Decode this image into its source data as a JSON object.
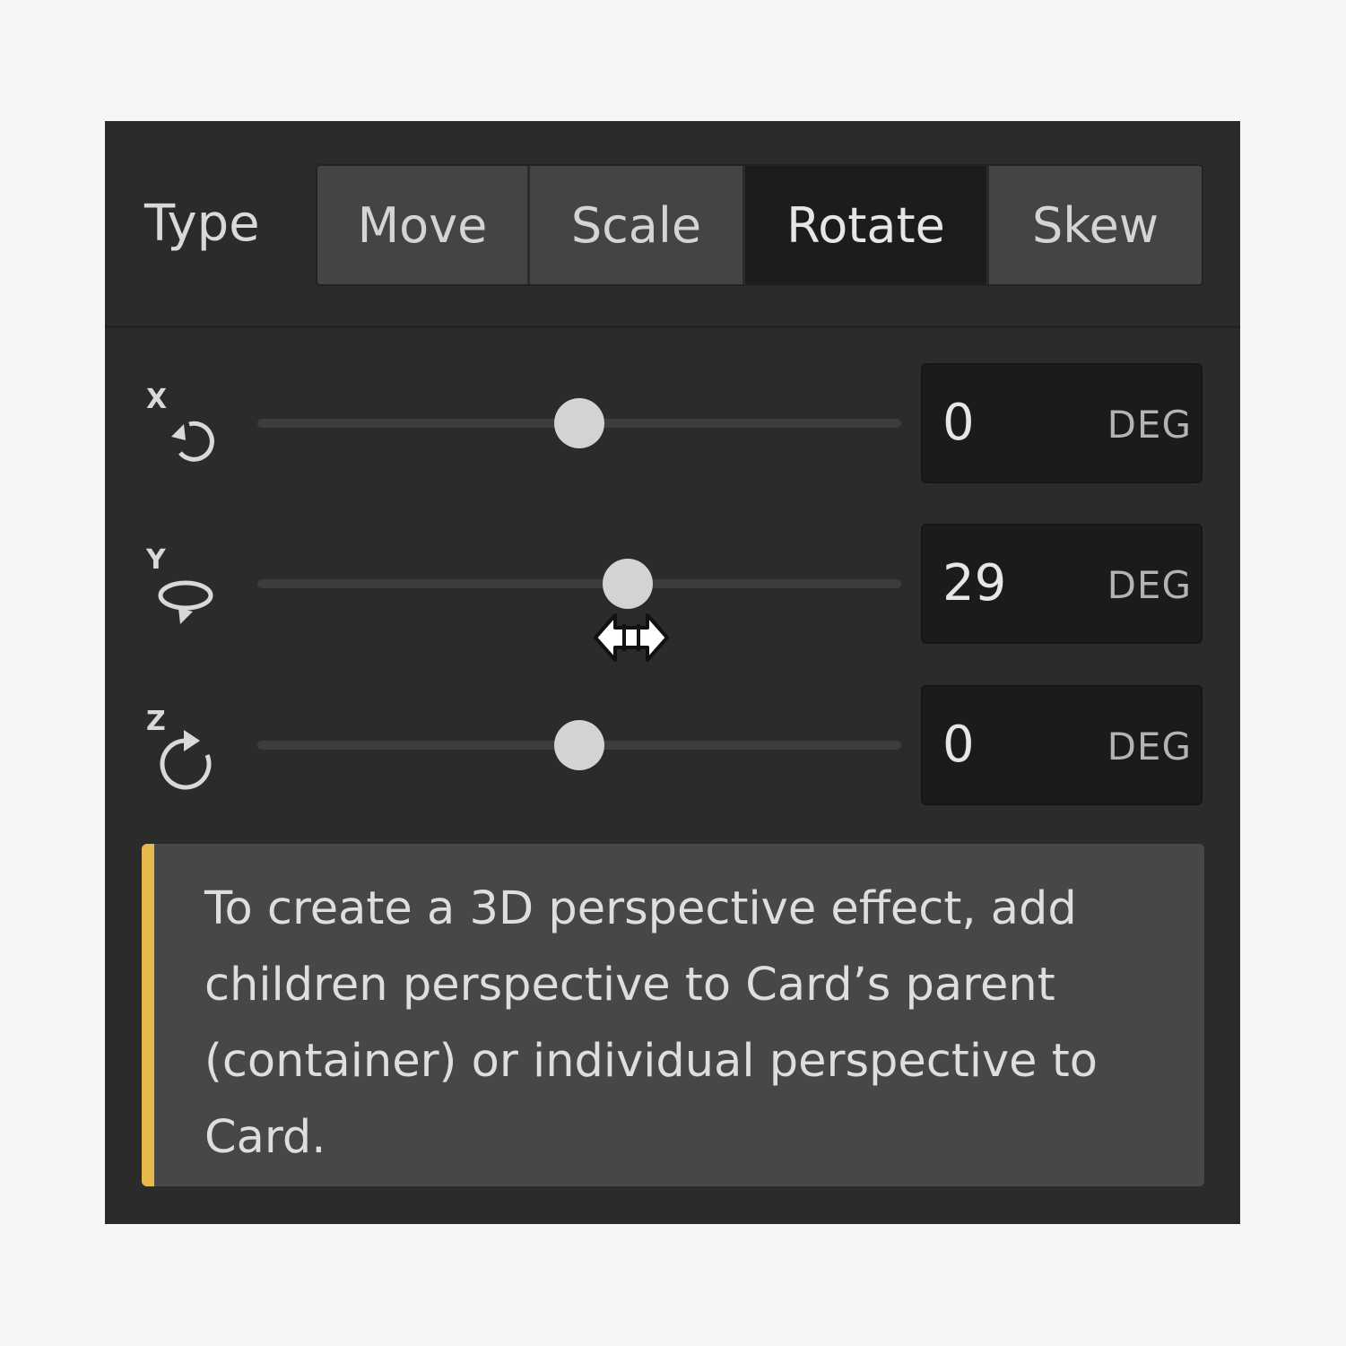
{
  "type_row": {
    "label": "Type",
    "options": [
      {
        "label": "Move",
        "active": false
      },
      {
        "label": "Scale",
        "active": false
      },
      {
        "label": "Rotate",
        "active": true
      },
      {
        "label": "Skew",
        "active": false
      }
    ]
  },
  "rotations": [
    {
      "axis": "X",
      "icon": "rotate-x-icon",
      "value": "0",
      "unit": "DEG",
      "slider_fraction": 0.5
    },
    {
      "axis": "Y",
      "icon": "rotate-y-icon",
      "value": "29",
      "unit": "DEG",
      "slider_fraction": 0.575
    },
    {
      "axis": "Z",
      "icon": "rotate-z-icon",
      "value": "0",
      "unit": "DEG",
      "slider_fraction": 0.5
    }
  ],
  "note": {
    "text": "To create a 3D perspective effect, add children perspective to Card’s parent (container) or individual perspective to Card.",
    "accent_color": "#e7b84b"
  },
  "colors": {
    "panel": "#2b2b2b",
    "segment_active": "#1c1c1c",
    "segment_inactive": "#444444",
    "thumb": "#d3d3d3"
  },
  "cursor": "resize-horizontal-icon"
}
